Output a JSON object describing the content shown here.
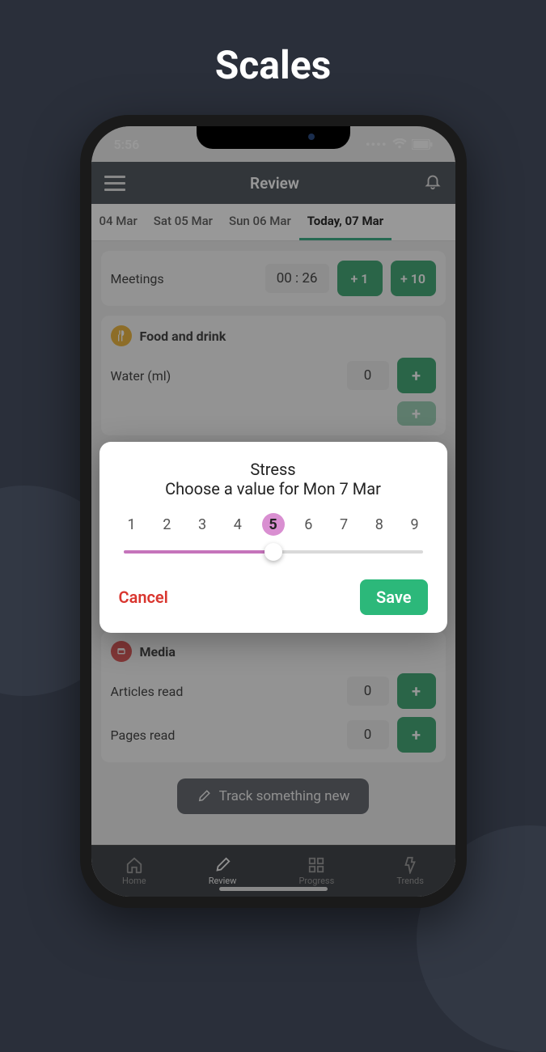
{
  "promo_title": "Scales",
  "status": {
    "time": "5:56"
  },
  "topbar": {
    "title": "Review"
  },
  "date_tabs": [
    "04 Mar",
    "Sat 05 Mar",
    "Sun 06 Mar",
    "Today, 07 Mar"
  ],
  "meetings": {
    "label": "Meetings",
    "value": "00 : 26",
    "inc1": "+ 1",
    "inc10": "+ 10"
  },
  "food": {
    "title": "Food and drink",
    "rows": [
      {
        "label": "Water (ml)",
        "value": "0"
      }
    ]
  },
  "media": {
    "title": "Media",
    "rows": [
      {
        "label": "Articles read",
        "value": "0"
      },
      {
        "label": "Pages read",
        "value": "0"
      }
    ]
  },
  "track_new": "Track something new",
  "nav": [
    "Home",
    "Review",
    "Progress",
    "Trends"
  ],
  "modal": {
    "title": "Stress",
    "subtitle": "Choose a value for Mon 7 Mar",
    "values": [
      "1",
      "2",
      "3",
      "4",
      "5",
      "6",
      "7",
      "8",
      "9"
    ],
    "selected_index": 4,
    "cancel": "Cancel",
    "save": "Save"
  },
  "colors": {
    "food_icon_bg": "#e9a91f",
    "media_icon_bg": "#d33c3c"
  }
}
